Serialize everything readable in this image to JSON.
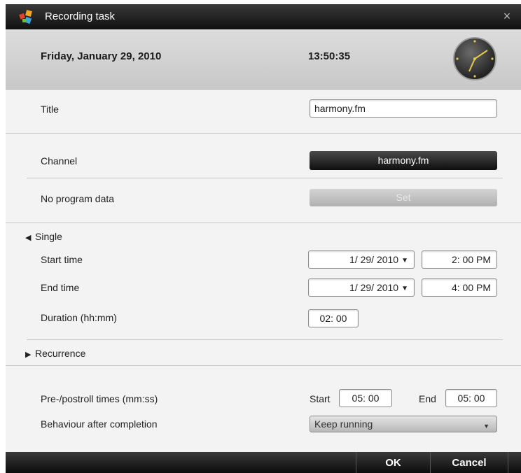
{
  "window": {
    "title": "Recording task",
    "close_glyph": "×"
  },
  "header": {
    "date": "Friday, January 29, 2010",
    "time": "13:50:35"
  },
  "fields": {
    "title_label": "Title",
    "title_value": "harmony.fm",
    "channel_label": "Channel",
    "channel_button": "harmony.fm",
    "program_label": "No program data",
    "set_button": "Set"
  },
  "single": {
    "toggle_glyph": "◀",
    "heading": "Single",
    "start_label": "Start time",
    "start_date": "1/ 29/ 2010",
    "start_time": "2: 00  PM",
    "end_label": "End time",
    "end_date": "1/ 29/ 2010",
    "end_time": "4: 00  PM",
    "duration_label": "Duration (hh:mm)",
    "duration_value": "02: 00",
    "date_dropdown_glyph": "▼"
  },
  "recurrence": {
    "toggle_glyph": "▶",
    "heading": "Recurrence"
  },
  "rolls": {
    "label": "Pre-/postroll times (mm:ss)",
    "start_label": "Start",
    "start_value": "05: 00",
    "end_label": "End",
    "end_value": "05: 00"
  },
  "behaviour": {
    "label": "Behaviour after completion",
    "selected": "Keep running",
    "caret_glyph": "▼"
  },
  "footer": {
    "ok": "OK",
    "cancel": "Cancel"
  },
  "colors": {
    "title_bar": "#1a1a1a",
    "header_bg": "#d2d2d2",
    "panel_bg": "#f3f3f3",
    "accent_button": "#1a1a1a"
  },
  "icons": {
    "app": "app-logo-icon",
    "clock": "analog-clock-icon",
    "close": "close-icon"
  }
}
